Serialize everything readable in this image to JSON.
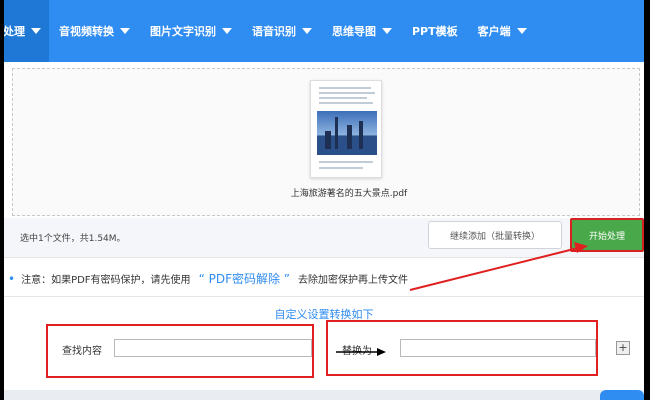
{
  "nav": {
    "items": [
      {
        "label": "档处理"
      },
      {
        "label": "音视频转换"
      },
      {
        "label": "图片文字识别"
      },
      {
        "label": "语音识别"
      },
      {
        "label": "思维导图"
      },
      {
        "label": "PPT模板"
      },
      {
        "label": "客户端"
      }
    ]
  },
  "upload": {
    "file_name": "上海旅游著名的五大景点.pdf"
  },
  "status": {
    "selected_info": "选中1个文件，共1.54M。",
    "continue_button": "继续添加（批量转换）",
    "start_button": "开始处理"
  },
  "notice": {
    "prefix": "注意：如果PDF有密码保护，请先使用",
    "link": "“ PDF密码解除 ”",
    "suffix": "去除加密保护再上传文件"
  },
  "custom": {
    "title": "自定义设置转换如下",
    "find_label": "查找内容",
    "find_value": "",
    "replace_label": "替换为",
    "replace_value": "",
    "add_button": "+"
  },
  "colors": {
    "nav_bg": "#2f8cf0",
    "start_button": "#49a84a",
    "annotation": "#e02020"
  }
}
